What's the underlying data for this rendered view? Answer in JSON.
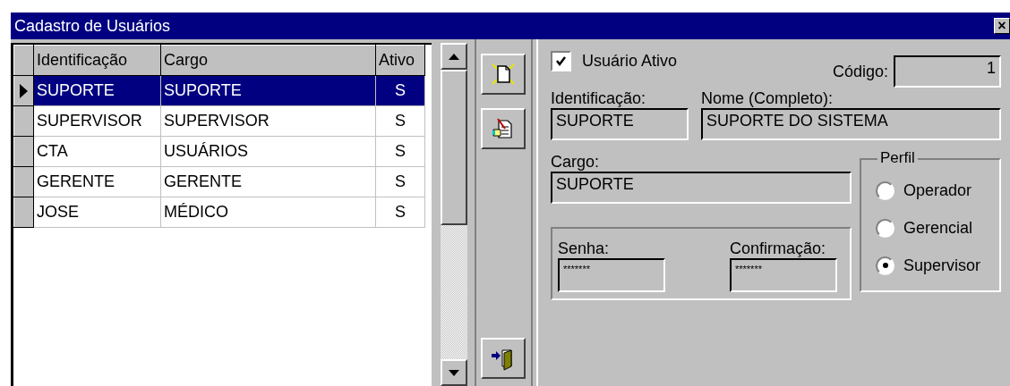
{
  "window": {
    "title": "Cadastro de Usuários",
    "close_glyph": "×"
  },
  "table": {
    "columns": [
      "Identificação",
      "Cargo",
      "Ativo"
    ],
    "rows": [
      {
        "cells": [
          "SUPORTE",
          "SUPORTE",
          "S"
        ],
        "selected": true
      },
      {
        "cells": [
          "SUPERVISOR",
          "SUPERVISOR",
          "S"
        ],
        "selected": false
      },
      {
        "cells": [
          "CTA",
          "USUÁRIOS",
          "S"
        ],
        "selected": false
      },
      {
        "cells": [
          "GERENTE",
          "GERENTE",
          "S"
        ],
        "selected": false
      },
      {
        "cells": [
          "JOSE",
          "MÉDICO",
          "S"
        ],
        "selected": false
      }
    ]
  },
  "form": {
    "active": {
      "label": "Usuário Ativo",
      "checked": true
    },
    "codigo": {
      "label": "Código:",
      "value": "1"
    },
    "identificacao": {
      "label": "Identificação:",
      "value": "SUPORTE"
    },
    "nome": {
      "label": "Nome (Completo):",
      "value": "SUPORTE DO SISTEMA"
    },
    "cargo": {
      "label": "Cargo:",
      "value": "SUPORTE"
    },
    "senha": {
      "label": "Senha:",
      "value": "*******"
    },
    "confirmacao": {
      "label": "Confirmação:",
      "value": "*******"
    },
    "perfil": {
      "title": "Perfil",
      "options": [
        {
          "label": "Operador",
          "selected": false
        },
        {
          "label": "Gerencial",
          "selected": false
        },
        {
          "label": "Supervisor",
          "selected": true
        }
      ]
    }
  }
}
